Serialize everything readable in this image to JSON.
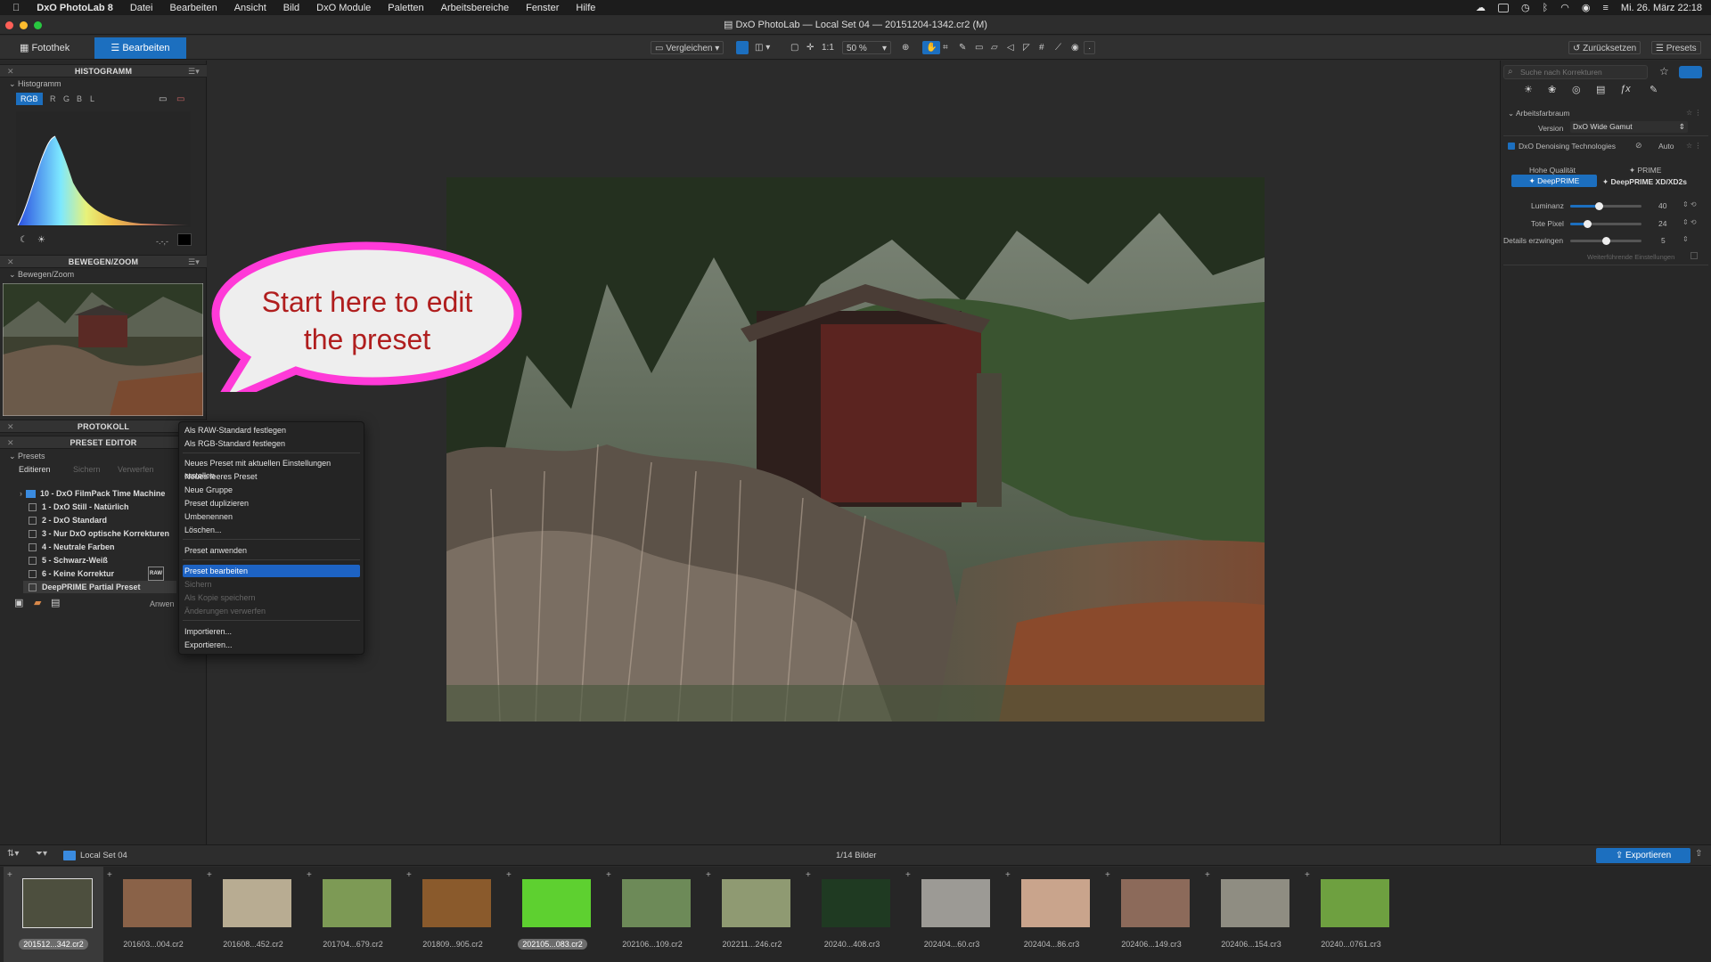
{
  "menubar": {
    "app": "DxO PhotoLab 8",
    "items": [
      "Datei",
      "Bearbeiten",
      "Ansicht",
      "Bild",
      "DxO Module",
      "Paletten",
      "Arbeitsbereiche",
      "Fenster",
      "Hilfe"
    ],
    "clock": "Mi. 26. März 22:18"
  },
  "window": {
    "title": "DxO PhotoLab — Local Set 04 — 20151204-1342.cr2 (M)"
  },
  "toolbar": {
    "tab_library": "Fotothek",
    "tab_edit": "Bearbeiten",
    "compare": "Vergleichen",
    "ratio": "1:1",
    "zoom": "50 %",
    "reset": "Zurücksetzen",
    "presets": "Presets"
  },
  "left": {
    "histogram_header": "HISTOGRAMM",
    "histogram_sub": "Histogramm",
    "channels": [
      "RGB",
      "R",
      "G",
      "B",
      "L"
    ],
    "hist_readout": "-.-,-",
    "move_header": "BEWEGEN/ZOOM",
    "move_sub": "Bewegen/Zoom",
    "history_header": "PROTOKOLL",
    "preset_header": "PRESET EDITOR",
    "presets_sub": "Presets",
    "edit_tab": "Editieren",
    "save_tab": "Sichern",
    "discard_tab": "Verwerfen",
    "apply_btn": "Anwen",
    "preset_list": [
      "10 - DxO FilmPack Time Machine",
      "1 - DxO Still - Natürlich",
      "2 - DxO Standard",
      "3 - Nur DxO optische Korrekturen",
      "4 - Neutrale Farben",
      "5 - Schwarz-Weiß",
      "6 - Keine Korrektur",
      "DeepPRIME Partial Preset"
    ]
  },
  "context_menu": {
    "items": [
      "Als RAW-Standard festlegen",
      "Als RGB-Standard festlegen",
      "Neues Preset mit aktuellen Einstellungen erstellen",
      "Neues leeres Preset",
      "Neue Gruppe",
      "Preset duplizieren",
      "Umbenennen",
      "Löschen...",
      "Preset anwenden",
      "Preset bearbeiten",
      "Sichern",
      "Als Kopie speichern",
      "Änderungen verwerfen",
      "Importieren...",
      "Exportieren..."
    ]
  },
  "callout": {
    "line1": "Start here to edit",
    "line2": "the preset"
  },
  "right": {
    "search_placeholder": "Suche nach Korrekturen",
    "workspace": "Arbeitsfarbraum",
    "version_label": "Version",
    "version_value": "DxO Wide Gamut",
    "denoise": "DxO Denoising Technologies",
    "auto": "Auto",
    "hq": "Hohe Qualität",
    "prime": "PRIME",
    "deepprime": "DeepPRIME",
    "deepprime_xd": "DeepPRIME XD/XD2s",
    "luminance_label": "Luminanz",
    "luminance_value": "40",
    "luminance_pct": 0.4,
    "deadpx_label": "Tote Pixel",
    "deadpx_value": "24",
    "deadpx_pct": 0.24,
    "details_label": "Details erzwingen",
    "details_value": "5",
    "details_pct": 0.5,
    "advanced": "Weiterführende Einstellungen"
  },
  "filmbar": {
    "set": "Local Set 04",
    "count": "1/14 Bilder",
    "export": "Exportieren"
  },
  "thumbnails": [
    {
      "label": "201512...342.cr2",
      "color": "#4d4f3e",
      "selected": true
    },
    {
      "label": "201603...004.cr2",
      "color": "#8a6248"
    },
    {
      "label": "201608...452.cr2",
      "color": "#b8ac92"
    },
    {
      "label": "201704...679.cr2",
      "color": "#7d9a55"
    },
    {
      "label": "201809...905.cr2",
      "color": "#8a5a2c"
    },
    {
      "label": "202105...083.cr2",
      "color": "#5ed030",
      "selected": true
    },
    {
      "label": "202106...109.cr2",
      "color": "#6d8a58"
    },
    {
      "label": "202211...246.cr2",
      "color": "#8f9a72"
    },
    {
      "label": "20240...408.cr3",
      "color": "#1f3a22"
    },
    {
      "label": "202404...60.cr3",
      "color": "#9c9a95"
    },
    {
      "label": "202404...86.cr3",
      "color": "#c9a48c"
    },
    {
      "label": "202406...149.cr3",
      "color": "#8c6a5a"
    },
    {
      "label": "202406...154.cr3",
      "color": "#8f8d82"
    },
    {
      "label": "20240...0761.cr3",
      "color": "#6ea040"
    }
  ]
}
